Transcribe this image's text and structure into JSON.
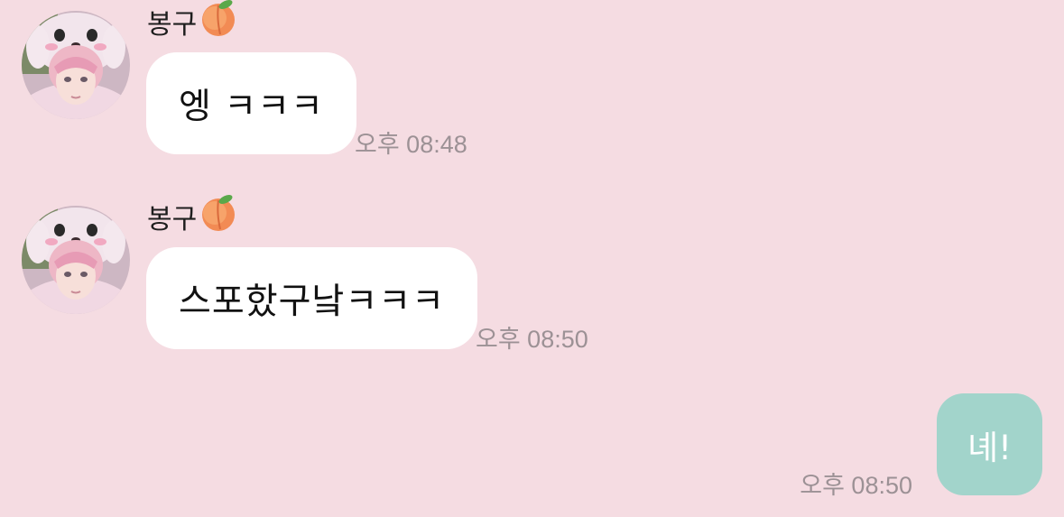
{
  "theme": {
    "background": "#f5dce2",
    "incoming_bubble": "#ffffff",
    "outgoing_bubble": "#a2d4cb",
    "time_color": "#9c9195"
  },
  "messages": [
    {
      "direction": "incoming",
      "sender": "봉구",
      "sender_emoji": "peach-icon",
      "text": "엥 ㅋㅋㅋ",
      "time": "오후 08:48"
    },
    {
      "direction": "incoming",
      "sender": "봉구",
      "sender_emoji": "peach-icon",
      "text": "스포핬구낰ㅋㅋㅋ",
      "time": "오후 08:50"
    },
    {
      "direction": "outgoing",
      "text": "녜!",
      "time": "오후 08:50"
    }
  ]
}
